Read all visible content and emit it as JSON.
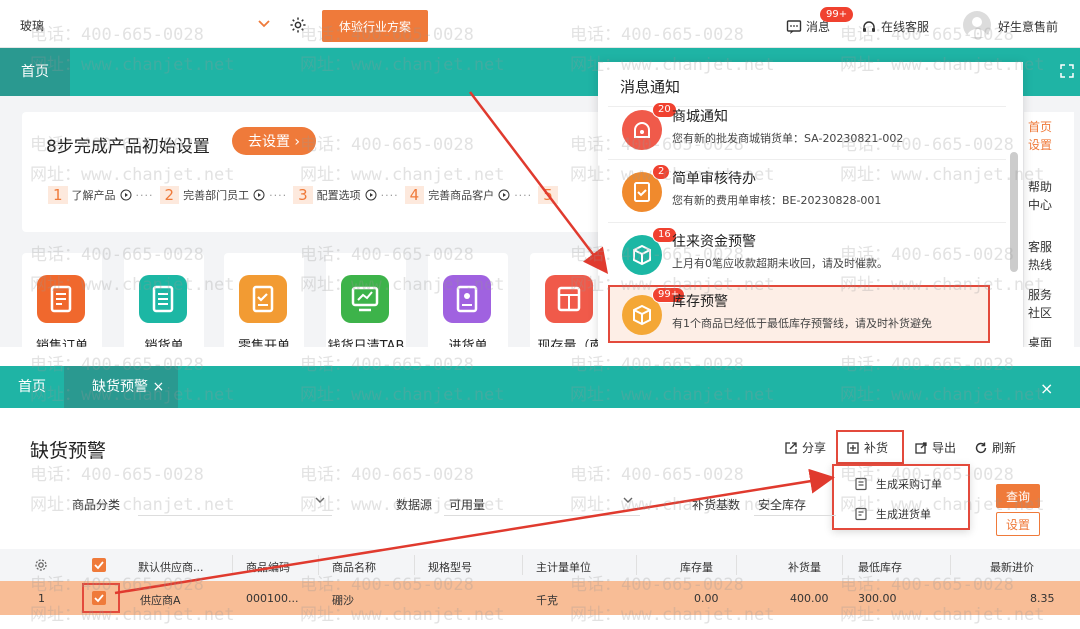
{
  "topbar": {
    "company": "玻璃",
    "solution_btn": "体验行业方案",
    "msg_label": "消息",
    "msg_badge": "99+",
    "service_label": "在线客服",
    "user_name": "好生意售前"
  },
  "top_tabs": {
    "home": "首页"
  },
  "setup": {
    "title": "8步完成产品初始设置",
    "btn": "去设置",
    "steps": [
      {
        "num": "1",
        "label": "了解产品"
      },
      {
        "num": "2",
        "label": "完善部门员工"
      },
      {
        "num": "3",
        "label": "配置选项"
      },
      {
        "num": "4",
        "label": "完善商品客户"
      },
      {
        "num": "5",
        "label": ""
      }
    ]
  },
  "apps": [
    {
      "label": "销售订单",
      "color": "#f0682d"
    },
    {
      "label": "销货单",
      "color": "#1cb7a4"
    },
    {
      "label": "零售开单",
      "color": "#f29b33"
    },
    {
      "label": "钱货日清TAB",
      "color": "#3db34a"
    },
    {
      "label": "进货单",
      "color": "#a062e0"
    },
    {
      "label": "现存量（南",
      "color": "#f05a4a"
    }
  ],
  "side_links": [
    "首页设置",
    "帮助中心",
    "客服热线",
    "服务社区",
    "桌面"
  ],
  "notifications": {
    "title": "消息通知",
    "items": [
      {
        "name": "商城通知",
        "desc": "您有新的批发商城销货单：SA-20230821-002",
        "badge": "20",
        "color": "#f05a4a"
      },
      {
        "name": "简单审核待办",
        "desc": "您有新的费用单审核：BE-20230828-001",
        "badge": "2",
        "color": "#f08a2d"
      },
      {
        "name": "往来资金预警",
        "desc": "上月有0笔应收款超期未收回，请及时催款。",
        "badge": "16",
        "color": "#1cb7a4"
      },
      {
        "name": "库存预警",
        "desc": "有1个商品已经低于最低库存预警线，请及时补货避免",
        "badge": "99+",
        "color": "#f4a736"
      }
    ]
  },
  "bottom_tabs": {
    "home": "首页",
    "active": "缺货预警",
    "active_close": "×",
    "close_all": "×"
  },
  "page": {
    "title": "缺货预警",
    "actions": {
      "share": "分享",
      "replenish": "补货",
      "export": "导出",
      "refresh": "刷新"
    },
    "dropdown": [
      "生成采购订单",
      "生成进货单"
    ],
    "filters": {
      "category_label": "商品分类",
      "datasource_label": "数据源",
      "datasource_value": "可用量",
      "basis_label": "补货基数",
      "basis_value": "安全库存"
    },
    "buttons": {
      "query": "查询",
      "settings": "设置"
    }
  },
  "table": {
    "columns": [
      "默认供应商...",
      "商品编码",
      "商品名称",
      "规格型号",
      "主计量单位",
      "库存量",
      "补货量",
      "最低库存",
      "最新进价"
    ],
    "rows": [
      {
        "index": "1",
        "supplier": "供应商A",
        "code": "000100...",
        "name": "硼沙",
        "spec": "",
        "unit": "千克",
        "stock": "0.00",
        "replenish": "400.00",
        "min_stock": "300.00",
        "price": "8.35"
      }
    ]
  },
  "watermarks": {
    "phone": "电话：400-665-0028",
    "site": "网址：www.chanjet.net"
  }
}
